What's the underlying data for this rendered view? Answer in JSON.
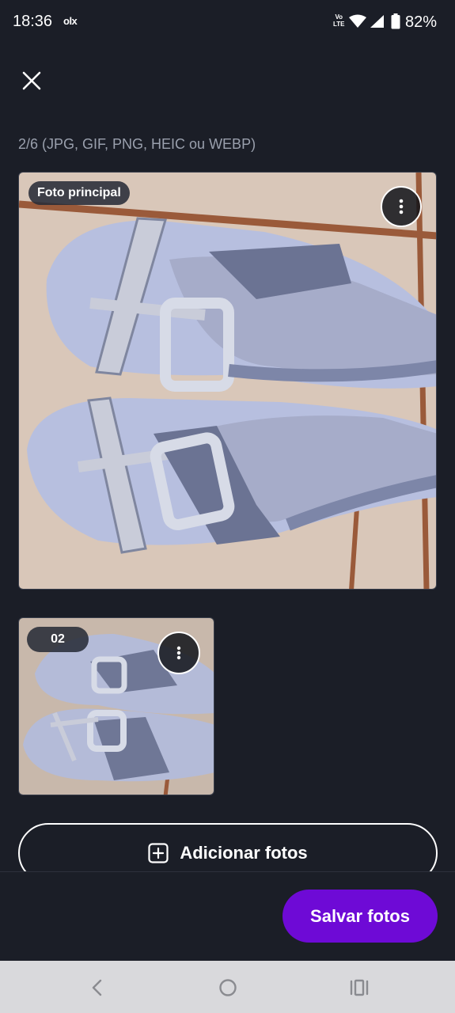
{
  "status_bar": {
    "time": "18:36",
    "app_notification": "olx",
    "network_line1": "Vo",
    "network_line2": "LTE",
    "battery": "82%"
  },
  "header": {
    "close_icon": "close-icon",
    "photo_counter": "2/6 (JPG, GIF, PNG, HEIC ou WEBP)"
  },
  "photos": [
    {
      "badge": "Foto principal",
      "menu_icon": "more-vertical-icon"
    },
    {
      "badge": "02",
      "menu_icon": "more-vertical-icon"
    }
  ],
  "actions": {
    "add_photos_label": "Adicionar fotos",
    "add_icon": "plus-square-icon",
    "save_label": "Salvar fotos"
  },
  "colors": {
    "background": "#1b1e27",
    "primary": "#6e0ad6",
    "muted_text": "#9aa0ad"
  },
  "nav_bar": {
    "back_icon": "back-icon",
    "home_icon": "home-icon",
    "recents_icon": "recents-icon"
  }
}
